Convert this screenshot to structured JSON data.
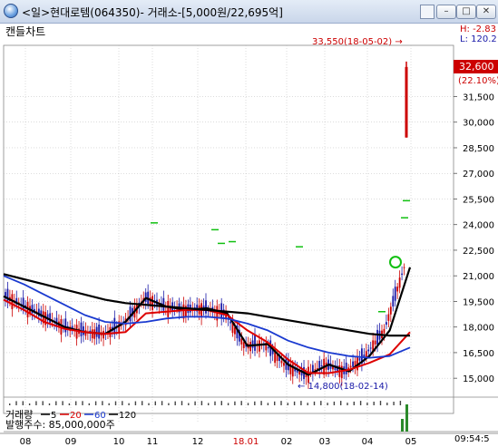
{
  "window": {
    "title": "<일>현대로템(064350)- 거래소-[5,000원/22,695억]",
    "chart_mode_label": "캔들차트",
    "buttons": [
      "–",
      "□",
      "✕"
    ]
  },
  "high_low": {
    "high_label": "H: -2.83",
    "low_label": "L: 120.2"
  },
  "annotations": {
    "max_label": "33,550(18-05-02) →",
    "min_label": "← 14,800(18-02-14)"
  },
  "price_axis": {
    "current_price": "32,600",
    "current_change": "(22.10%)",
    "ticks": [
      "31,500",
      "30,000",
      "28,500",
      "27,000",
      "25,500",
      "24,000",
      "22,500",
      "21,000",
      "19,500",
      "18,000",
      "16,500",
      "15,000"
    ]
  },
  "volume_panel": {
    "legend_label": "거래량",
    "ma_labels": [
      "5",
      "20",
      "60",
      "120"
    ],
    "shares_label": "발행주수: 85,000,000주"
  },
  "time_axis": {
    "labels": [
      "08",
      "09",
      "10",
      "11",
      "12",
      "18.01",
      "02",
      "03",
      "04",
      "05"
    ],
    "clock": "09:54:5"
  },
  "colors": {
    "up": "#cc0000",
    "down": "#1a1aa8",
    "ma5": "#000000",
    "ma20": "#dd0000",
    "ma60": "#1a3ad0",
    "ma120": "#000000",
    "grid": "#b8b8b8",
    "signal": "#10c010"
  },
  "chart_data": {
    "type": "line",
    "title": "",
    "xlabel": "",
    "ylabel": "",
    "ylim": [
      14000,
      34500
    ],
    "x_ticks": [
      "08",
      "09",
      "10",
      "11",
      "12",
      "18.01",
      "02",
      "03",
      "04",
      "05"
    ],
    "series": [
      {
        "name": "5",
        "values": [
          19800,
          19200,
          18600,
          18000,
          17700,
          17600,
          18300,
          19700,
          19200,
          19000,
          19100,
          18800,
          16900,
          17000,
          15800,
          15200,
          15800,
          15400,
          16300,
          17800,
          21500
        ]
      },
      {
        "name": "20",
        "values": [
          19600,
          19000,
          18300,
          17900,
          17700,
          17600,
          17700,
          18800,
          18900,
          19000,
          19000,
          18700,
          17800,
          17100,
          16100,
          15300,
          15300,
          15500,
          15900,
          16400,
          17700
        ]
      },
      {
        "name": "60",
        "values": [
          21000,
          20500,
          19900,
          19300,
          18700,
          18300,
          18200,
          18300,
          18500,
          18600,
          18600,
          18500,
          18200,
          17800,
          17200,
          16800,
          16500,
          16300,
          16200,
          16300,
          16800
        ]
      },
      {
        "name": "120",
        "values": [
          21100,
          20800,
          20500,
          20200,
          19900,
          19600,
          19400,
          19300,
          19200,
          19100,
          19000,
          18900,
          18800,
          18600,
          18400,
          18200,
          18000,
          17800,
          17600,
          17500,
          17500
        ]
      }
    ],
    "annotations": [
      {
        "label": "33,550(18-05-02)",
        "value": 33550
      },
      {
        "label": "14,800(18-02-14)",
        "value": 14800
      }
    ],
    "current_price": 32600,
    "current_change_pct": 22.1
  }
}
